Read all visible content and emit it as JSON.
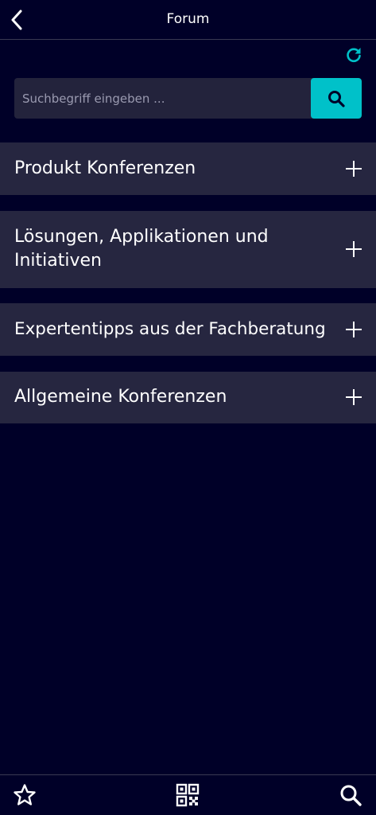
{
  "header": {
    "title": "Forum",
    "back_icon": "chevron-left-icon"
  },
  "refresh": {
    "icon": "refresh-icon",
    "color": "#00c1c9"
  },
  "search": {
    "placeholder": "Suchbegriff eingeben ...",
    "value": "",
    "button_icon": "search-icon",
    "button_color": "#00c1c9"
  },
  "sections": [
    {
      "label": "Produkt Konferenzen",
      "icon": "plus-icon"
    },
    {
      "label": "Lösungen, Applikationen und Initiativen",
      "icon": "plus-icon"
    },
    {
      "label": "Expertentipps aus der Fachberatung",
      "icon": "plus-icon"
    },
    {
      "label": "Allgemeine Konferenzen",
      "icon": "plus-icon"
    }
  ],
  "bottom_nav": [
    {
      "icon": "star-icon"
    },
    {
      "icon": "qr-code-icon"
    },
    {
      "icon": "search-icon"
    }
  ],
  "colors": {
    "background": "#000028",
    "section_bg": "#262640",
    "accent": "#00c1c9"
  }
}
